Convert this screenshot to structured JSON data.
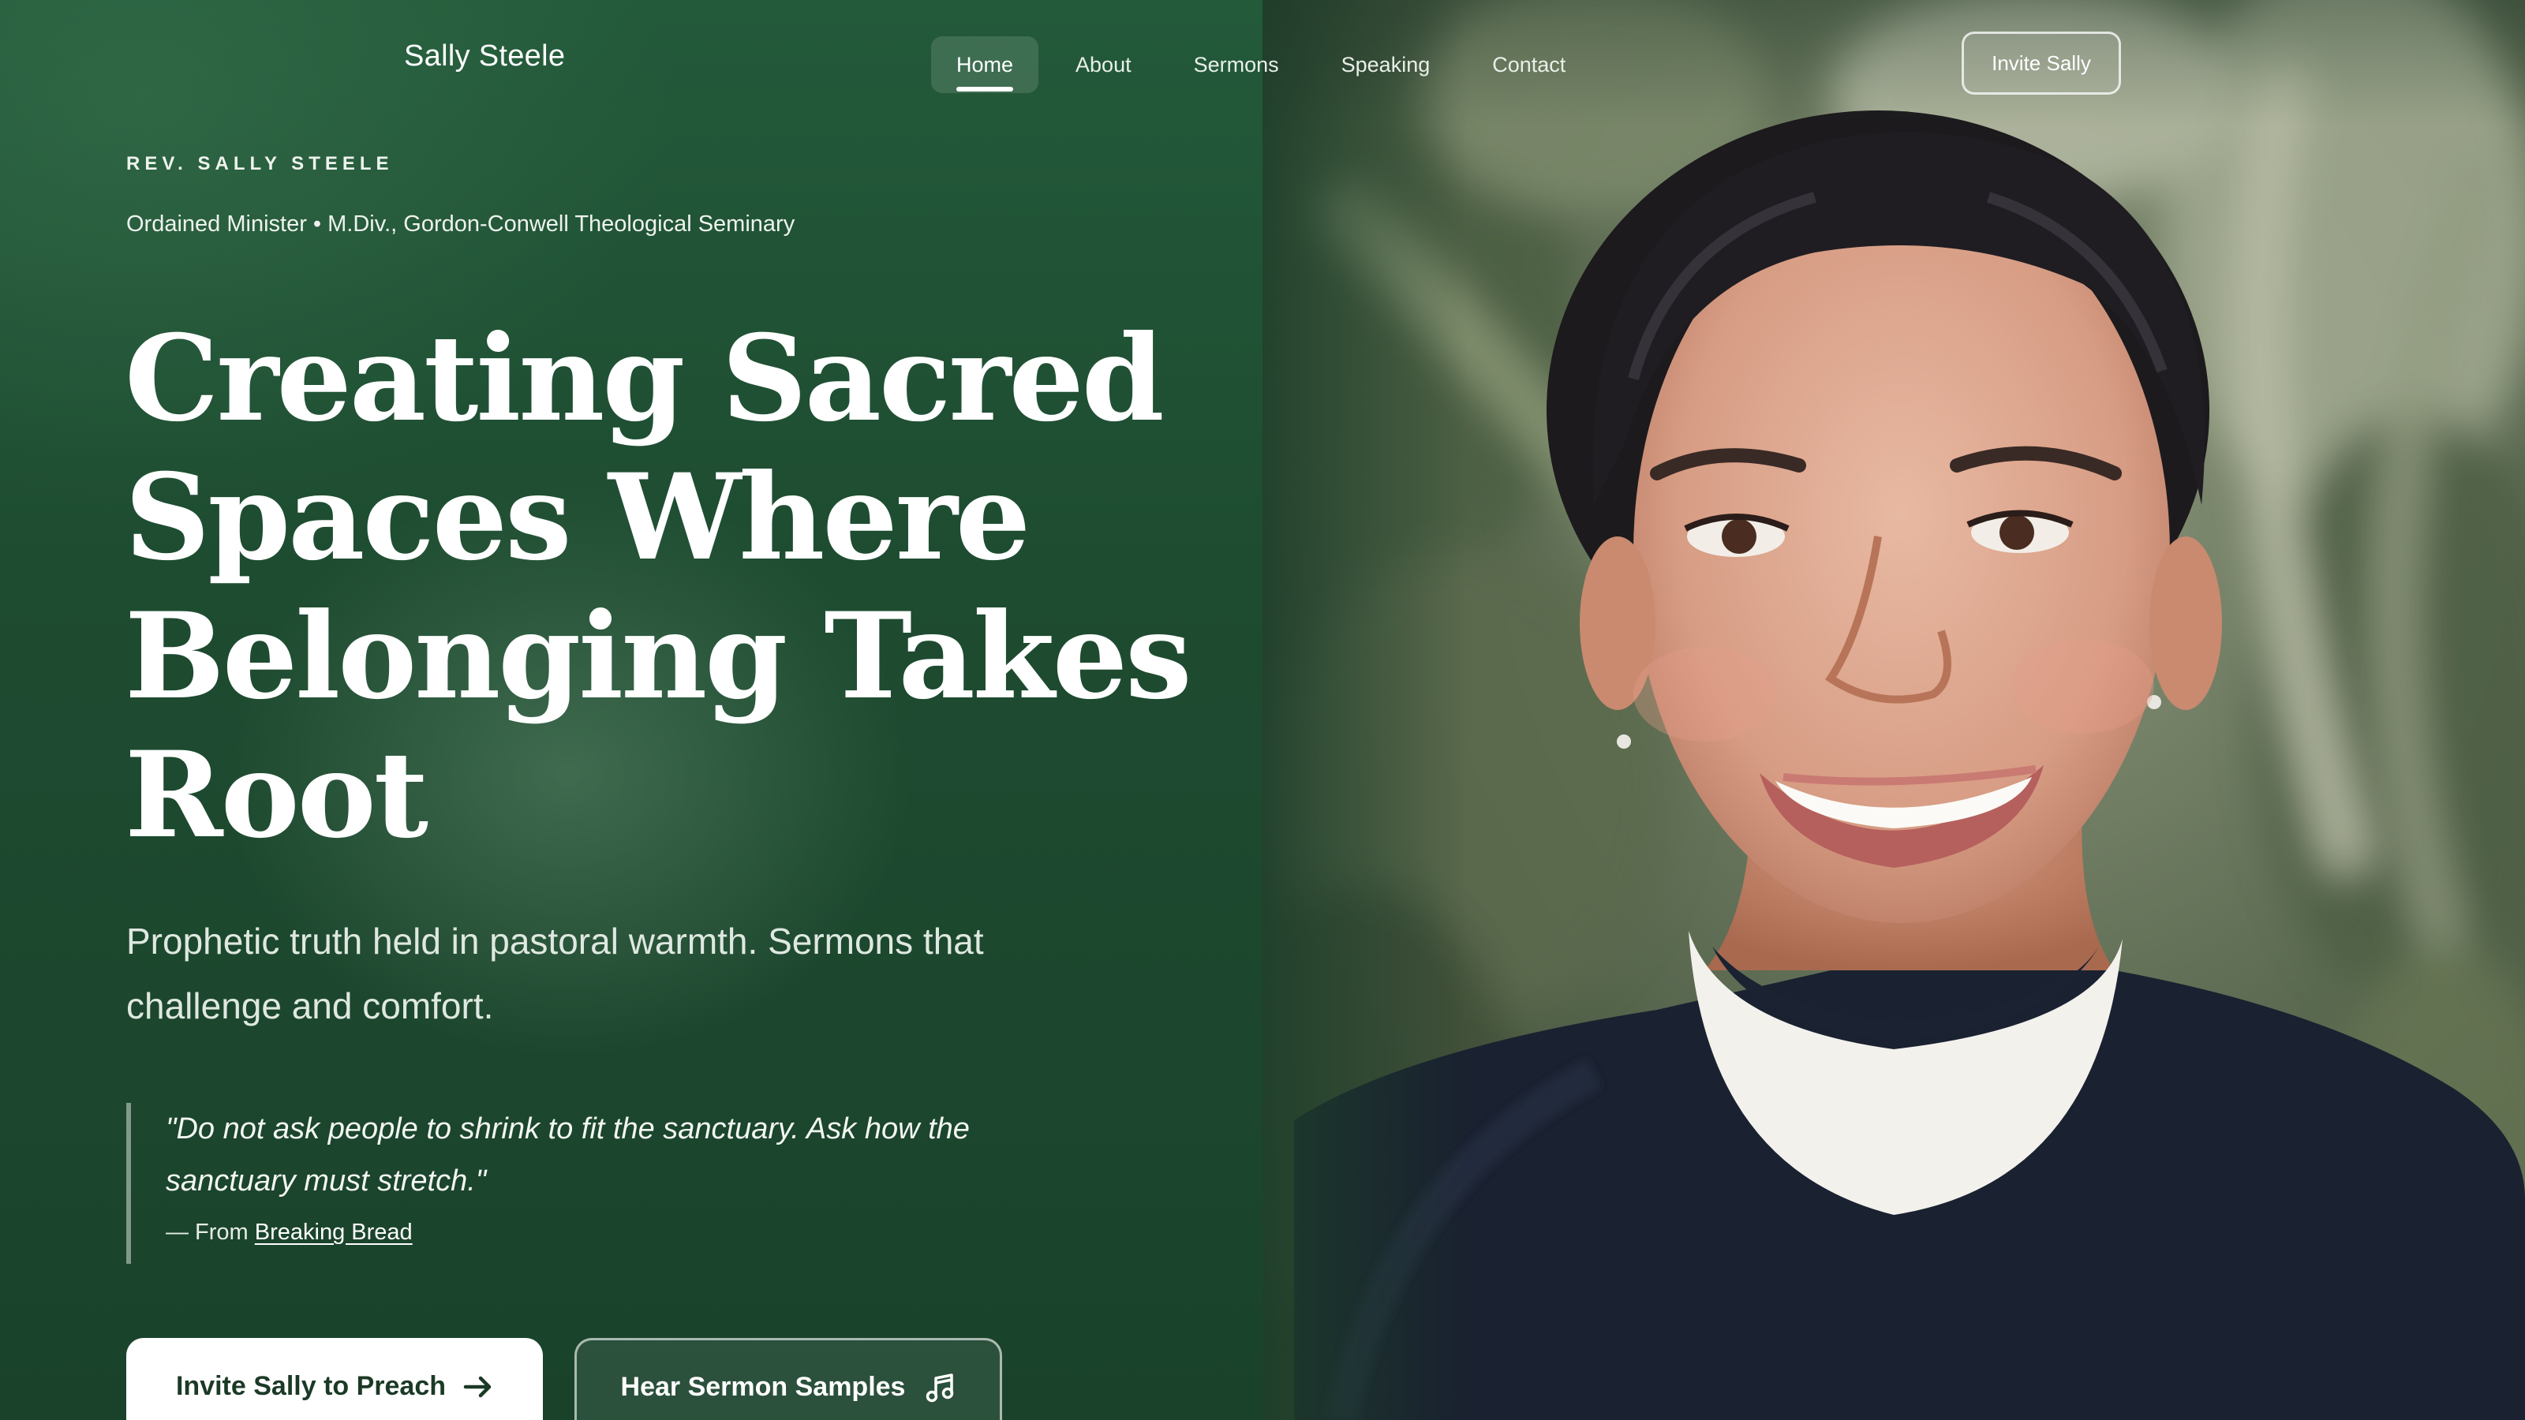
{
  "header": {
    "brand": "Sally Steele",
    "nav": [
      {
        "label": "Home",
        "active": true
      },
      {
        "label": "About",
        "active": false
      },
      {
        "label": "Sermons",
        "active": false
      },
      {
        "label": "Speaking",
        "active": false
      },
      {
        "label": "Contact",
        "active": false
      }
    ],
    "invite_label": "Invite Sally"
  },
  "hero": {
    "eyebrow": "REV. SALLY STEELE",
    "credentials": "Ordained Minister • M.Div., Gordon-Conwell Theological Seminary",
    "headline": "Creating Sacred Spaces Where Belonging Takes Root",
    "subhead": "Prophetic truth held in pastoral warmth. Sermons that challenge and comfort.",
    "quote": {
      "text": "\"Do not ask people to shrink to fit the sanctuary. Ask how the sanctuary must stretch.\"",
      "source_prefix": "— From",
      "source_title": "Breaking Bread"
    },
    "cta_primary": {
      "label": "Invite Sally to Preach",
      "icon": "arrow-right-icon"
    },
    "cta_secondary": {
      "label": "Hear Sermon Samples",
      "icon": "music-note-icon"
    }
  },
  "portrait": {
    "icon": "portrait-photo"
  },
  "colors": {
    "accent_green": "#1e4c31",
    "button_text": "#1b3a26"
  }
}
